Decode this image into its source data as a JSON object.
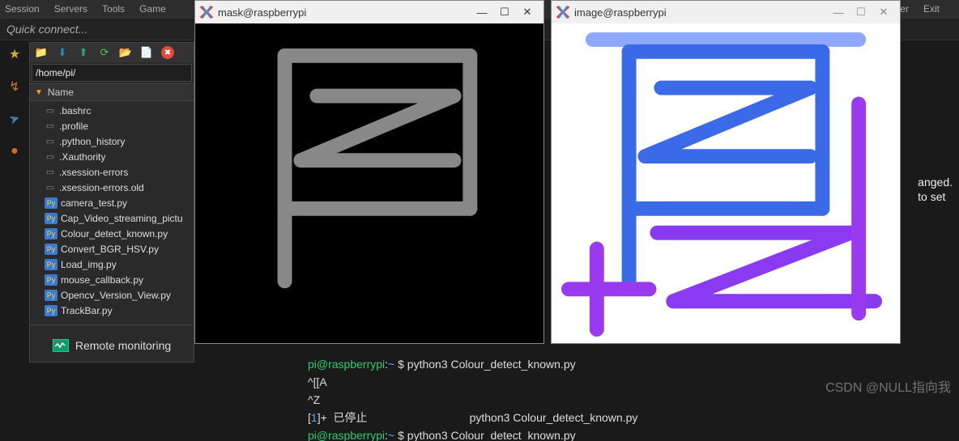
{
  "menubar": [
    "Session",
    "Servers",
    "Tools",
    "Game"
  ],
  "menubar_right": [
    "ver",
    "Exit"
  ],
  "quickconnect": "Quick connect...",
  "leftstrip": [
    {
      "name": "star-icon",
      "glyph": "★",
      "color": "#d4a43a"
    },
    {
      "name": "rocket-icon",
      "glyph": "↯",
      "color": "#c07a4a"
    },
    {
      "name": "send-icon",
      "glyph": "➤",
      "color": "#4a7aa8"
    },
    {
      "name": "globe-icon",
      "glyph": "●",
      "color": "#d46a2a"
    }
  ],
  "toolbar": [
    {
      "name": "folder-icon",
      "glyph": "📁",
      "color": "#e8a838"
    },
    {
      "name": "download-icon",
      "glyph": "⬇",
      "color": "#2e88c0"
    },
    {
      "name": "upload-icon",
      "glyph": "⬆",
      "color": "#2ea86a"
    },
    {
      "name": "refresh-icon",
      "glyph": "⟳",
      "color": "#4ac04a"
    },
    {
      "name": "newfolder-icon",
      "glyph": "📂",
      "color": "#e8a838"
    },
    {
      "name": "newfile-icon",
      "glyph": "📄",
      "color": "#4a9ae8"
    },
    {
      "name": "delete-icon",
      "glyph": "✖",
      "color": "#e04a3a"
    }
  ],
  "path": "/home/pi/",
  "colhead": "Name",
  "files": [
    {
      "name": ".bashrc",
      "icon": "file",
      "color": "#888"
    },
    {
      "name": ".profile",
      "icon": "file",
      "color": "#888"
    },
    {
      "name": ".python_history",
      "icon": "file",
      "color": "#888"
    },
    {
      "name": ".Xauthority",
      "icon": "file",
      "color": "#888"
    },
    {
      "name": ".xsession-errors",
      "icon": "file",
      "color": "#888"
    },
    {
      "name": ".xsession-errors.old",
      "icon": "file",
      "color": "#888"
    },
    {
      "name": "camera_test.py",
      "icon": "py",
      "color": "#3a7ad0"
    },
    {
      "name": "Cap_Video_streaming_pictu",
      "icon": "py",
      "color": "#3a7ad0"
    },
    {
      "name": "Colour_detect_known.py",
      "icon": "py",
      "color": "#3a7ad0"
    },
    {
      "name": "Convert_BGR_HSV.py",
      "icon": "py",
      "color": "#3a7ad0"
    },
    {
      "name": "Load_img.py",
      "icon": "py",
      "color": "#3a7ad0"
    },
    {
      "name": "mouse_callback.py",
      "icon": "py",
      "color": "#3a7ad0"
    },
    {
      "name": "Opencv_Version_View.py",
      "icon": "py",
      "color": "#3a7ad0"
    },
    {
      "name": "TrackBar.py",
      "icon": "py",
      "color": "#3a7ad0"
    }
  ],
  "remotemon": "Remote monitoring",
  "windows": {
    "mask": {
      "title": "mask@raspberrypi"
    },
    "image": {
      "title": "image@raspberrypi"
    }
  },
  "righttxt": {
    "l1": "anged.",
    "l2": "to set"
  },
  "terminal": {
    "line1_user": "pi@raspberrypi",
    "line1_sep": ":",
    "line1_path": "~",
    "line1_prompt": " $ ",
    "line1_cmd": "python3 Colour_detect_known.py",
    "line2": "^[[A",
    "line3": "^Z",
    "line4_pre": "[",
    "line4_num": "1",
    "line4_post": "]+  已停止",
    "line4_right": "python3 Colour_detect_known.py",
    "line5_user": "pi@raspberrypi",
    "line5_sep": ":",
    "line5_path": "~",
    "line5_prompt": " $ ",
    "line5_cmd": "python3 Colour_detect_known.py"
  },
  "watermark": "CSDN @NULL指向我"
}
